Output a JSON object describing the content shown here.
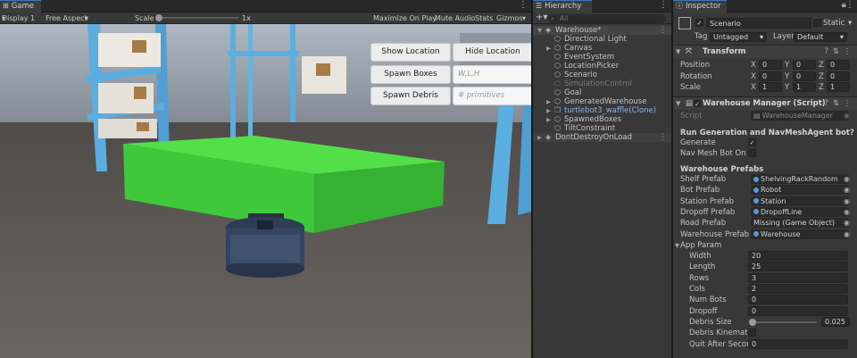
{
  "game": {
    "tab": "Game",
    "display": "Display 1",
    "aspect": "Free Aspect",
    "scale_label": "Scale",
    "scale_value": "1x",
    "maximize": "Maximize On Play",
    "mute": "Mute Audio",
    "stats": "Stats",
    "gizmos": "Gizmos",
    "buttons": {
      "show_location": "Show Location",
      "hide_location": "Hide Location",
      "spawn_boxes": "Spawn Boxes",
      "spawn_debris": "Spawn Debris"
    },
    "inputs": {
      "wlh_placeholder": "W,L,H",
      "primitives_placeholder": "# primitives"
    }
  },
  "hierarchy": {
    "tab": "Hierarchy",
    "search_placeholder": "All",
    "root": "Warehouse*",
    "items": [
      {
        "label": "Directional Light",
        "depth": 1,
        "expandable": false,
        "dim": false,
        "icon": "gameobject-icon"
      },
      {
        "label": "Canvas",
        "depth": 1,
        "expandable": true,
        "dim": false,
        "icon": "gameobject-icon"
      },
      {
        "label": "EventSystem",
        "depth": 1,
        "expandable": false,
        "dim": false,
        "icon": "gameobject-icon"
      },
      {
        "label": "LocationPicker",
        "depth": 1,
        "expandable": false,
        "dim": false,
        "icon": "gameobject-icon"
      },
      {
        "label": "Scenario",
        "depth": 1,
        "expandable": false,
        "dim": false,
        "icon": "gameobject-icon"
      },
      {
        "label": "SimulationControl",
        "depth": 1,
        "expandable": false,
        "dim": true,
        "icon": "gameobject-icon"
      },
      {
        "label": "Goal",
        "depth": 1,
        "expandable": false,
        "dim": false,
        "icon": "gameobject-icon"
      },
      {
        "label": "GeneratedWarehouse",
        "depth": 1,
        "expandable": true,
        "dim": false,
        "icon": "gameobject-icon"
      },
      {
        "label": "turtlebot3_waffle(Clone)",
        "depth": 1,
        "expandable": true,
        "dim": false,
        "icon": "prefab-icon"
      },
      {
        "label": "SpawnedBoxes",
        "depth": 1,
        "expandable": true,
        "dim": false,
        "icon": "gameobject-icon"
      },
      {
        "label": "TiltConstraint",
        "depth": 1,
        "expandable": false,
        "dim": false,
        "icon": "gameobject-icon"
      }
    ],
    "dontdestroy": "DontDestroyOnLoad"
  },
  "inspector": {
    "tab": "Inspector",
    "object_name": "Scenario",
    "static_label": "Static",
    "tag_label": "Tag",
    "tag_value": "Untagged",
    "layer_label": "Layer",
    "layer_value": "Default",
    "transform": {
      "title": "Transform",
      "rows": [
        {
          "label": "Position",
          "x": "0",
          "y": "0",
          "z": "0"
        },
        {
          "label": "Rotation",
          "x": "0",
          "y": "0",
          "z": "0"
        },
        {
          "label": "Scale",
          "x": "1",
          "y": "1",
          "z": "1"
        }
      ]
    },
    "script_component": {
      "title": "Warehouse Manager (Script)",
      "script_label": "Script",
      "script_value": "WarehouseManager",
      "section_run": "Run Generation and NavMeshAgent bot?",
      "generate_label": "Generate",
      "generate_checked": true,
      "navmesh_label": "Nav Mesh Bot On",
      "navmesh_checked": false,
      "section_prefabs": "Warehouse Prefabs",
      "prefabs": [
        {
          "label": "Shelf Prefab",
          "value": "ShelvingRackRandom"
        },
        {
          "label": "Bot Prefab",
          "value": "Robot"
        },
        {
          "label": "Station Prefab",
          "value": "Station"
        },
        {
          "label": "Dropoff Prefab",
          "value": "DropoffLine"
        },
        {
          "label": "Road Prefab",
          "value": "Missing (Game Object)"
        },
        {
          "label": "Warehouse Prefab",
          "value": "Warehouse"
        }
      ],
      "app_param_label": "App Param",
      "params": [
        {
          "label": "Width",
          "value": "20"
        },
        {
          "label": "Length",
          "value": "25"
        },
        {
          "label": "Rows",
          "value": "3"
        },
        {
          "label": "Cols",
          "value": "2"
        },
        {
          "label": "Num Bots",
          "value": "0"
        },
        {
          "label": "Dropoff",
          "value": "0"
        }
      ],
      "debris_size_label": "Debris Size",
      "debris_size_value": "0.025",
      "debris_size_fraction": 0.025,
      "debris_kinematic_label": "Debris Kinematic",
      "debris_kinematic_checked": false,
      "quit_label": "Quit After Seconds",
      "quit_value": "0"
    }
  },
  "colors": {
    "accent": "#3a79bb",
    "platform": "#3fc83b",
    "rack": "#5aaee0"
  }
}
